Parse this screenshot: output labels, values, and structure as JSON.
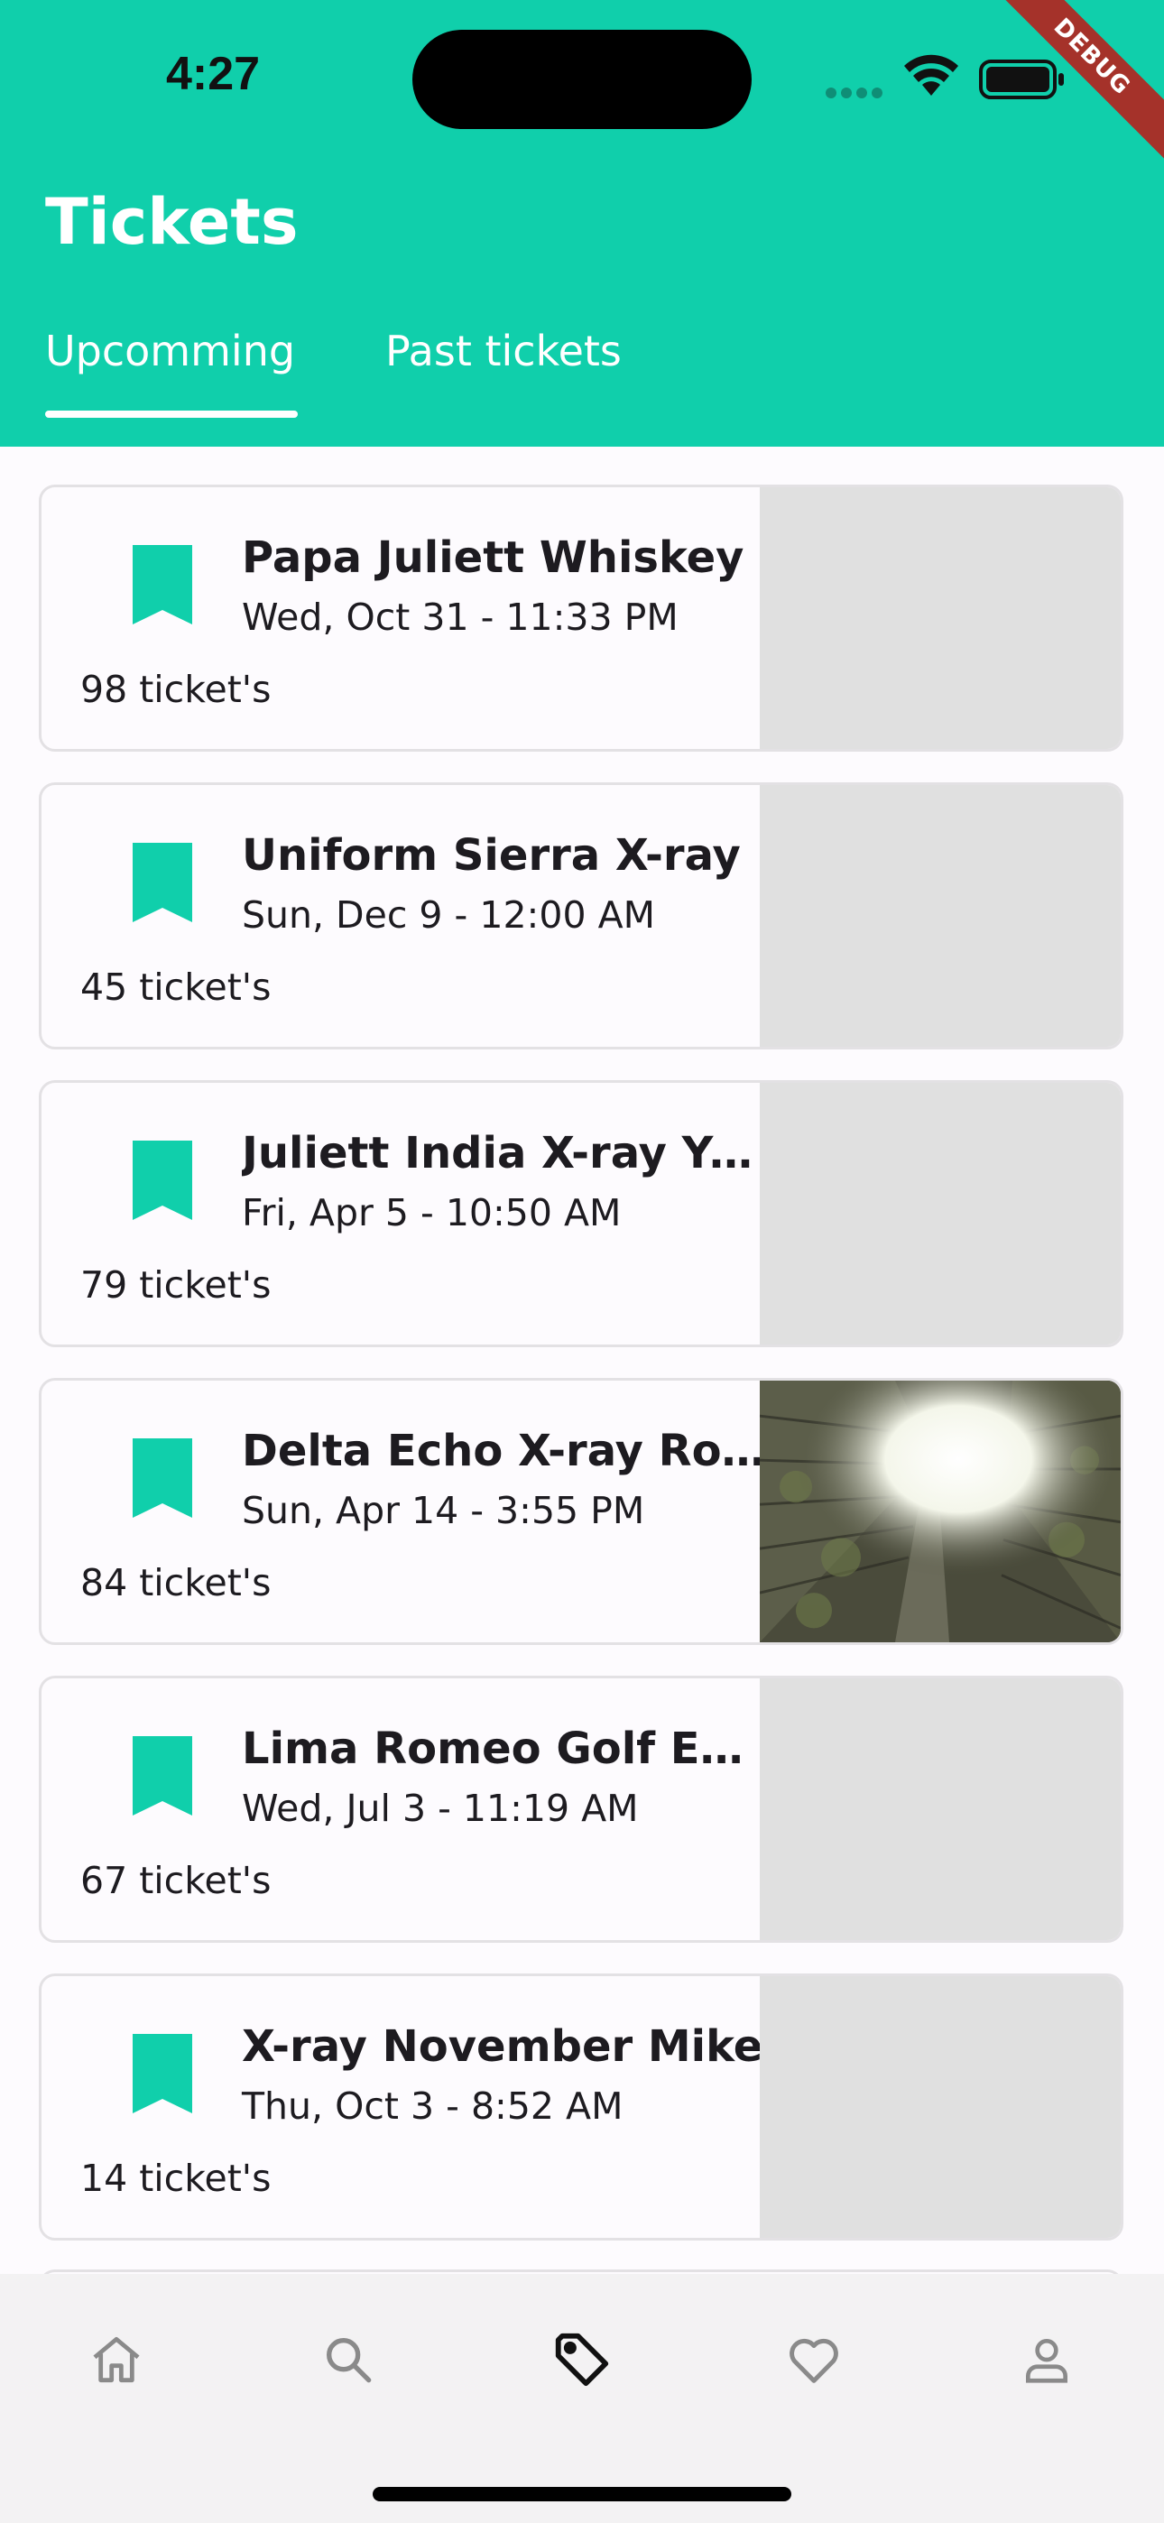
{
  "status_bar": {
    "time": "4:27"
  },
  "debug_banner": "DEBUG",
  "header": {
    "title": "Tickets"
  },
  "tabs": [
    {
      "label": "Upcomming",
      "selected": true
    },
    {
      "label": "Past tickets",
      "selected": false
    }
  ],
  "tickets": [
    {
      "title": "Papa Juliett Whiskey",
      "date": "Wed, Oct 31 - 11:33 PM",
      "count": "98 ticket's"
    },
    {
      "title": "Uniform Sierra X-ray",
      "date": "Sun, Dec 9 - 12:00 AM",
      "count": "45 ticket's"
    },
    {
      "title": "Juliett India X-ray Yankee",
      "date": "Fri, Apr 5 - 10:50 AM",
      "count": "79 ticket's"
    },
    {
      "title": "Delta Echo X-ray Romeo",
      "date": "Sun, Apr 14 - 3:55 PM",
      "count": "84 ticket's"
    },
    {
      "title": "Lima Romeo Golf Echo",
      "date": "Wed, Jul 3 - 11:19 AM",
      "count": "67 ticket's"
    },
    {
      "title": "X-ray November Mike",
      "date": "Thu, Oct 3 - 8:52 AM",
      "count": "14 ticket's"
    }
  ],
  "colors": {
    "accent": "#10cfab",
    "placeholder": "#e0e0e0",
    "nav_bg": "#f3f2f3"
  },
  "bottom_nav": [
    {
      "icon": "home-icon",
      "selected": false
    },
    {
      "icon": "search-icon",
      "selected": false
    },
    {
      "icon": "tag-icon",
      "selected": true
    },
    {
      "icon": "heart-icon",
      "selected": false
    },
    {
      "icon": "person-icon",
      "selected": false
    }
  ]
}
